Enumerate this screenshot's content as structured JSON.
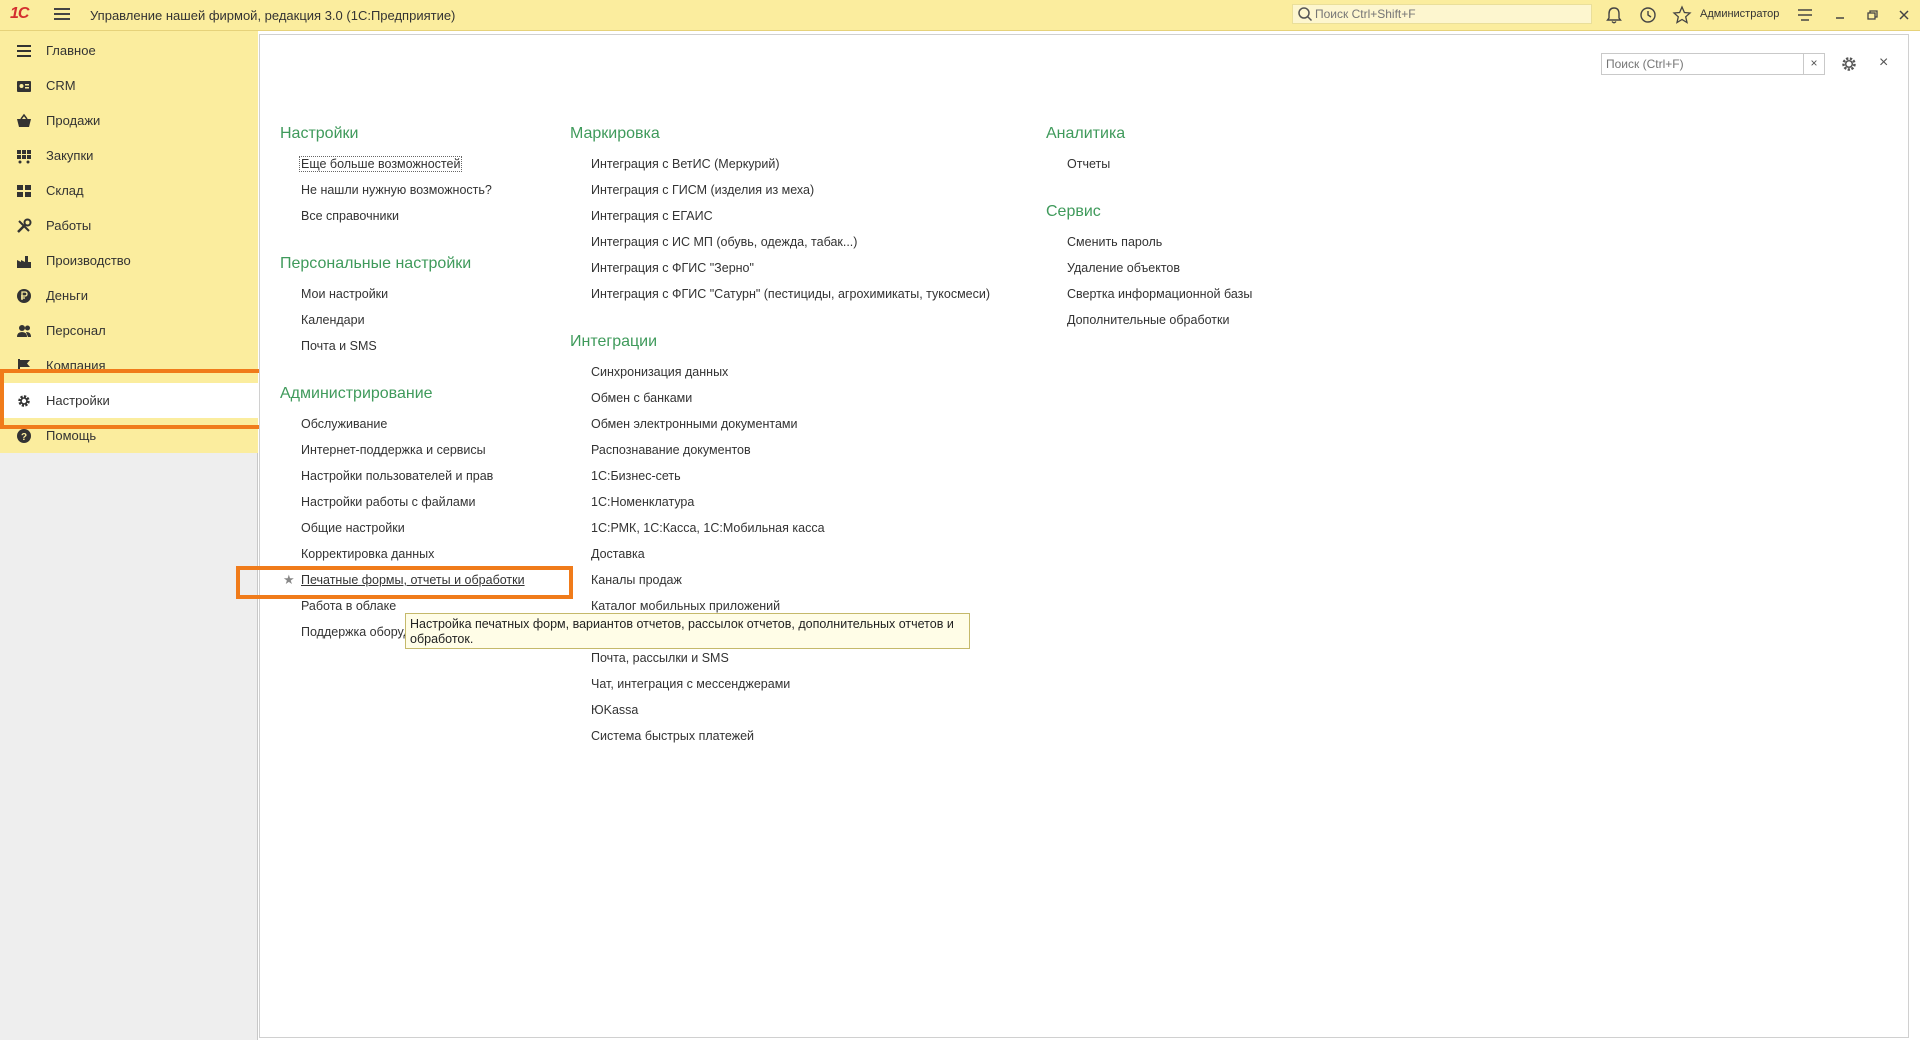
{
  "titlebar": {
    "logo": "1С",
    "app_title": "Управление нашей фирмой, редакция 3.0  (1С:Предприятие)",
    "search_placeholder": "Поиск Ctrl+Shift+F",
    "user": "Администратор",
    "icons": [
      "menu-icon",
      "search-icon",
      "bell-icon",
      "history-icon",
      "star-icon",
      "settings-list-icon",
      "minimize-icon",
      "restore-icon",
      "close-icon"
    ]
  },
  "sidebar": {
    "items": [
      {
        "label": "Главное",
        "icon": "hamburger-icon"
      },
      {
        "label": "CRM",
        "icon": "crm-icon"
      },
      {
        "label": "Продажи",
        "icon": "basket-icon"
      },
      {
        "label": "Закупки",
        "icon": "cart-icon"
      },
      {
        "label": "Склад",
        "icon": "warehouse-icon"
      },
      {
        "label": "Работы",
        "icon": "tools-icon"
      },
      {
        "label": "Производство",
        "icon": "factory-icon"
      },
      {
        "label": "Деньги",
        "icon": "ruble-icon"
      },
      {
        "label": "Персонал",
        "icon": "people-icon"
      },
      {
        "label": "Компания",
        "icon": "flag-icon"
      },
      {
        "label": "Настройки",
        "icon": "gear-icon",
        "active": true
      },
      {
        "label": "Помощь",
        "icon": "help-icon"
      }
    ]
  },
  "main": {
    "search_placeholder": "Поиск (Ctrl+F)",
    "search_clear": "×",
    "close_label": "×",
    "col1": {
      "settings": {
        "title": "Настройки",
        "links": [
          "Еще больше возможностей",
          "Не нашли нужную возможность?",
          "Все справочники"
        ]
      },
      "personal": {
        "title": "Персональные настройки",
        "links": [
          "Мои настройки",
          "Календари",
          "Почта и SMS"
        ]
      },
      "admin": {
        "title": "Администрирование",
        "links": [
          "Обслуживание",
          "Интернет-поддержка и сервисы",
          "Настройки пользователей и прав",
          "Настройки работы с файлами",
          "Общие настройки",
          "Корректировка данных",
          "Печатные формы, отчеты и обработки",
          "Работа в облаке",
          "Поддержка оборудования"
        ]
      }
    },
    "col2": {
      "marking": {
        "title": "Маркировка",
        "links": [
          "Интеграция с ВетИС (Меркурий)",
          "Интеграция с ГИСМ (изделия из меха)",
          "Интеграция с ЕГАИС",
          "Интеграция с ИС МП (обувь, одежда, табак...)",
          "Интеграция с ФГИС \"Зерно\"",
          "Интеграция с ФГИС \"Сатурн\" (пестициды, агрохимикаты, тукосмеси)"
        ]
      },
      "integrations": {
        "title": "Интеграции",
        "links": [
          "Синхронизация данных",
          "Обмен с банками",
          "Обмен электронными документами",
          "Распознавание документов",
          "1С:Бизнес-сеть",
          "1С:Номенклатура",
          "1С:РМК, 1С:Касса, 1С:Мобильная касса",
          "Доставка",
          "Каналы продаж",
          "Каталог мобильных приложений",
          "",
          "Почта, рассылки и SMS",
          "Чат, интеграция с мессенджерами",
          "ЮKassa",
          "Система быстрых платежей"
        ]
      }
    },
    "col3": {
      "analytics": {
        "title": "Аналитика",
        "links": [
          "Отчеты"
        ]
      },
      "service": {
        "title": "Сервис",
        "links": [
          "Сменить пароль",
          "Удаление объектов",
          "Свертка информационной базы",
          "Дополнительные обработки"
        ]
      }
    },
    "tooltip": "Настройка печатных форм, вариантов отчетов, рассылок отчетов, дополнительных отчетов и обработок."
  },
  "colors": {
    "accent_yellow": "#fbed9e",
    "section_green": "#3f9a5b",
    "highlight_orange": "#f07b1a"
  }
}
